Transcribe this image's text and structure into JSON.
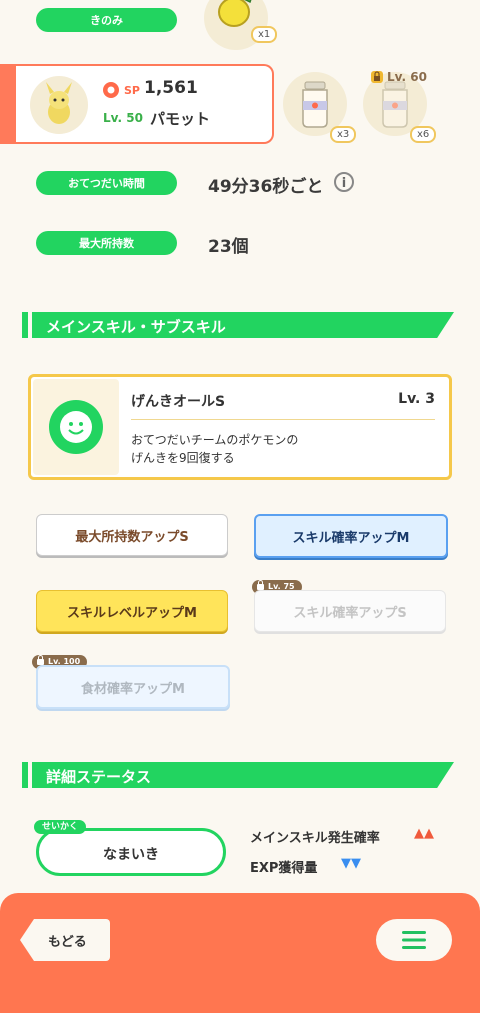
{
  "berry": {
    "label": "きのみ",
    "qty": "x1"
  },
  "pokemon": {
    "sp_label": "SP",
    "sp_value": "1,561",
    "level": "Lv. 50",
    "name": "パモット"
  },
  "ingredients": [
    {
      "qty": "x3",
      "locked": false
    },
    {
      "qty": "x6",
      "locked": true,
      "lock_label": "Lv. 60"
    }
  ],
  "help_time": {
    "label": "おてつだい時間",
    "value": "49分36秒ごと"
  },
  "max_inventory": {
    "label": "最大所持数",
    "value": "23個"
  },
  "skills_section": {
    "title": "メインスキル・サブスキル"
  },
  "main_skill": {
    "name": "げんきオールS",
    "level": "Lv. 3",
    "description_line1": "おてつだいチームのポケモンの",
    "description_line2": "げんきを9回復する"
  },
  "subskills": [
    {
      "label": "最大所持数アップS",
      "color": "white"
    },
    {
      "label": "スキル確率アップM",
      "color": "blue"
    },
    {
      "label": "スキルレベルアップM",
      "color": "gold"
    },
    {
      "label": "スキル確率アップS",
      "color": "white",
      "locked": true,
      "lock_label": "Lv. 75"
    },
    {
      "label": "食材確率アップM",
      "color": "blue",
      "locked": true,
      "lock_label": "Lv. 100"
    }
  ],
  "details_section": {
    "title": "詳細ステータス"
  },
  "nature": {
    "tag": "せいかく",
    "value": "なまいき",
    "up_label": "メインスキル発生確率",
    "up_marker": "▲▲",
    "down_label": "EXP獲得量",
    "down_marker": "▼▼"
  },
  "footer": {
    "back_label": "もどる"
  },
  "colors": {
    "accent_green": "#22d460",
    "footer_orange": "#ff7650",
    "up_red": "#f05a3c",
    "down_blue": "#3a8ef0"
  }
}
